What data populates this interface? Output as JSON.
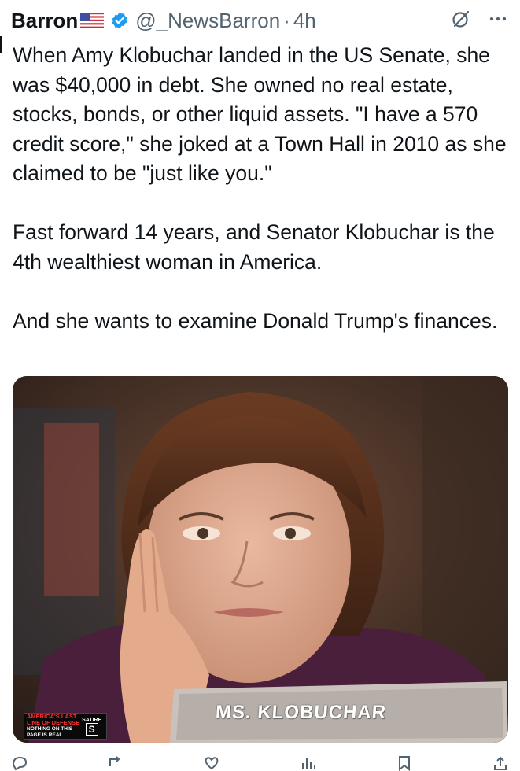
{
  "tweet": {
    "author_name": "Barron",
    "handle": "@_NewsBarron",
    "separator": "·",
    "time": "4h",
    "paragraphs": [
      "When Amy Klobuchar landed in the US Senate, she was $40,000 in debt. She owned no real estate, stocks, bonds, or other liquid assets. \"I have a 570 credit score,\" she joked at a Town Hall in 2010 as she claimed to be \"just like you.\"",
      "Fast forward 14 years, and Senator Klobuchar is the 4th wealthiest woman in America.",
      "And she wants to examine Donald Trump's finances."
    ]
  },
  "media": {
    "nameplate": "MS. KLOBUCHAR",
    "watermark": {
      "line1": "AMERICA'S LAST",
      "line2": "LINE OF DEFENSE",
      "line3": "NOTHING ON THIS",
      "line4": "PAGE IS REAL",
      "satire": "SATIRE",
      "logo_letter": "S"
    }
  },
  "icons": {
    "flag": "us-flag-emoji",
    "verified": "verified-badge-icon",
    "grok": "grok-icon",
    "more": "more-options-icon"
  },
  "colors": {
    "verified_blue": "#1d9bf0",
    "secondary_text": "#536471",
    "primary_text": "#0f1419"
  }
}
